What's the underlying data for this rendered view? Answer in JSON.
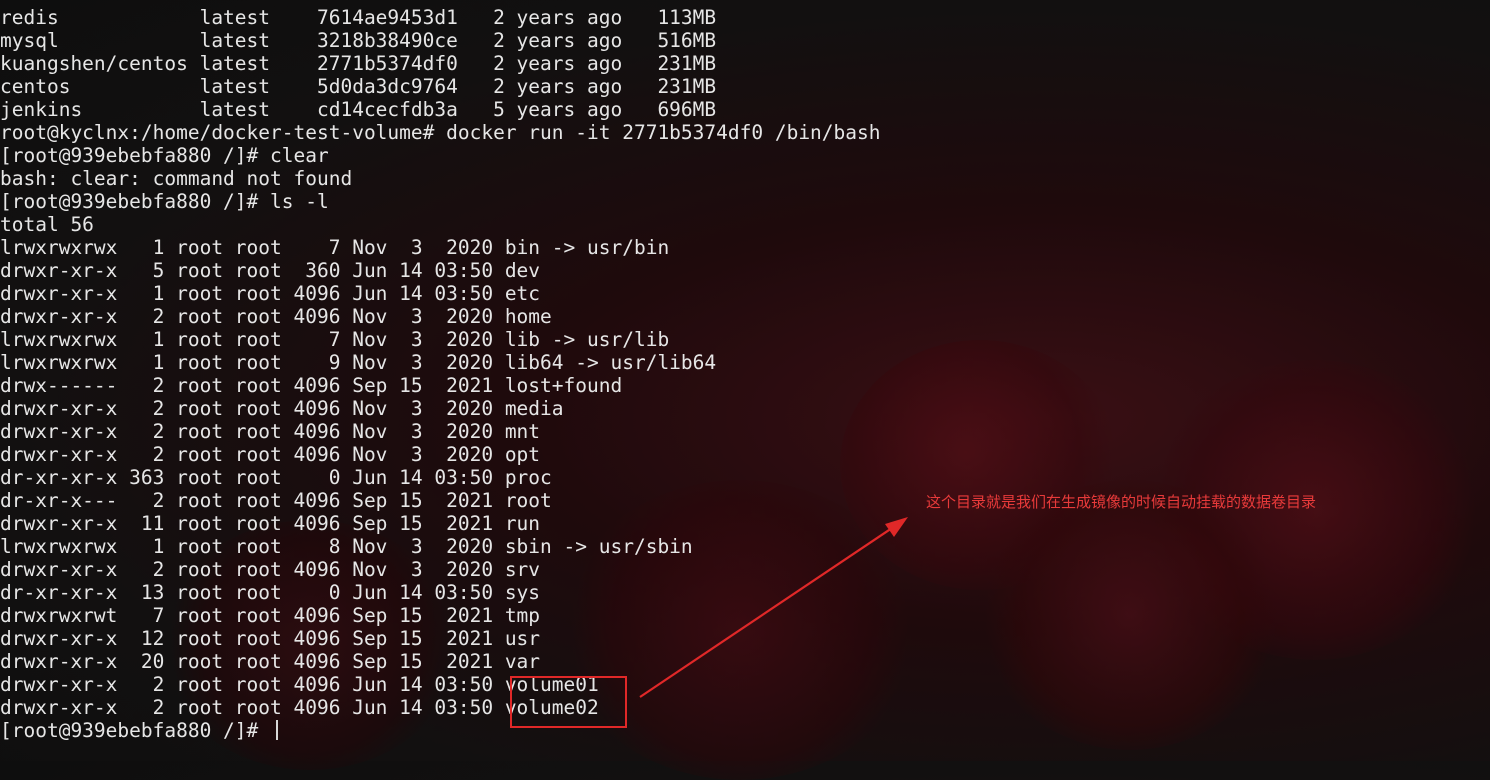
{
  "terminal": {
    "lines": [
      "redis            latest    7614ae9453d1   2 years ago   113MB",
      "mysql            latest    3218b38490ce   2 years ago   516MB",
      "kuangshen/centos latest    2771b5374df0   2 years ago   231MB",
      "centos           latest    5d0da3dc9764   2 years ago   231MB",
      "jenkins          latest    cd14cecfdb3a   5 years ago   696MB",
      "root@kyclnx:/home/docker-test-volume# docker run -it 2771b5374df0 /bin/bash",
      "[root@939ebebfa880 /]# clear",
      "bash: clear: command not found",
      "[root@939ebebfa880 /]# ls -l",
      "total 56",
      "lrwxrwxrwx   1 root root    7 Nov  3  2020 bin -> usr/bin",
      "drwxr-xr-x   5 root root  360 Jun 14 03:50 dev",
      "drwxr-xr-x   1 root root 4096 Jun 14 03:50 etc",
      "drwxr-xr-x   2 root root 4096 Nov  3  2020 home",
      "lrwxrwxrwx   1 root root    7 Nov  3  2020 lib -> usr/lib",
      "lrwxrwxrwx   1 root root    9 Nov  3  2020 lib64 -> usr/lib64",
      "drwx------   2 root root 4096 Sep 15  2021 lost+found",
      "drwxr-xr-x   2 root root 4096 Nov  3  2020 media",
      "drwxr-xr-x   2 root root 4096 Nov  3  2020 mnt",
      "drwxr-xr-x   2 root root 4096 Nov  3  2020 opt",
      "dr-xr-xr-x 363 root root    0 Jun 14 03:50 proc",
      "dr-xr-x---   2 root root 4096 Sep 15  2021 root",
      "drwxr-xr-x  11 root root 4096 Sep 15  2021 run",
      "lrwxrwxrwx   1 root root    8 Nov  3  2020 sbin -> usr/sbin",
      "drwxr-xr-x   2 root root 4096 Nov  3  2020 srv",
      "dr-xr-xr-x  13 root root    0 Jun 14 03:50 sys",
      "drwxrwxrwt   7 root root 4096 Sep 15  2021 tmp",
      "drwxr-xr-x  12 root root 4096 Sep 15  2021 usr",
      "drwxr-xr-x  20 root root 4096 Sep 15  2021 var",
      "drwxr-xr-x   2 root root 4096 Jun 14 03:50 volume01",
      "drwxr-xr-x   2 root root 4096 Jun 14 03:50 volume02",
      "[root@939ebebfa880 /]# "
    ],
    "text_color": "#e6e6e6"
  },
  "annotation": {
    "text": "这个目录就是我们在生成镜像的时候自动挂载的数据卷目录",
    "color": "#e02828"
  }
}
